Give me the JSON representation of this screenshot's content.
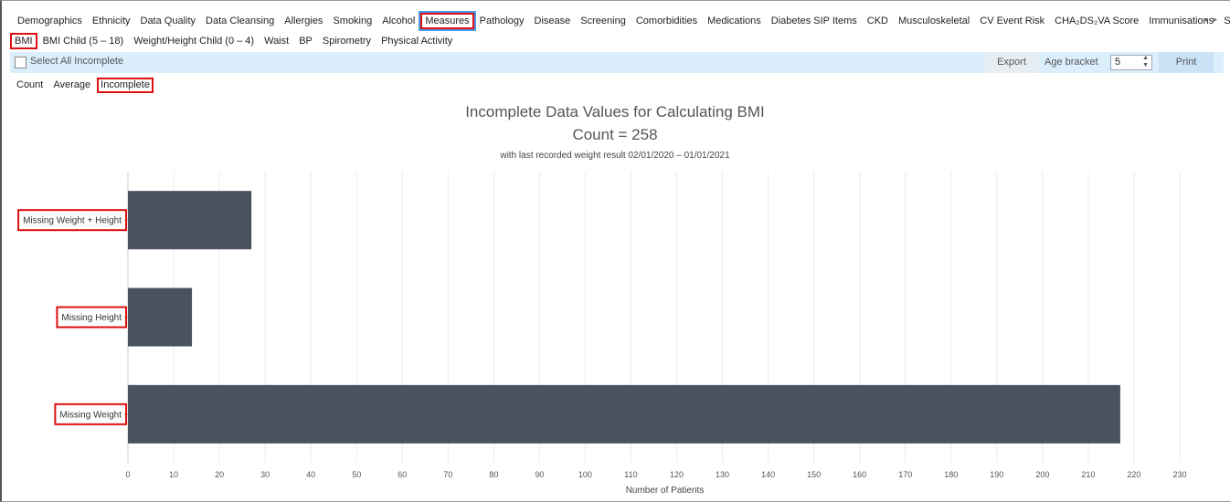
{
  "nav": {
    "main_tabs": [
      "Demographics",
      "Ethnicity",
      "Data Quality",
      "Data Cleansing",
      "Allergies",
      "Smoking",
      "Alcohol",
      "Measures",
      "Pathology",
      "Disease",
      "Screening",
      "Comorbidities",
      "Medications",
      "Diabetes SIP Items",
      "CKD",
      "Musculoskeletal",
      "CV Event Risk",
      "CHA₂DS₂VA Score",
      "Immunisations",
      "Standard Re"
    ],
    "main_active": "Measures",
    "sub_tabs": [
      "BMI",
      "BMI Child (5 – 18)",
      "Weight/Height Child (0 – 4)",
      "Waist",
      "BP",
      "Spirometry",
      "Physical Activity"
    ],
    "sub_active": "BMI"
  },
  "toolbar": {
    "select_all_label": "Select All Incomplete",
    "export_label": "Export",
    "age_bracket_label": "Age bracket",
    "age_bracket_value": "5",
    "print_label": "Print"
  },
  "modes": {
    "items": [
      "Count",
      "Average",
      "Incomplete"
    ],
    "active": "Incomplete"
  },
  "chart_data": {
    "type": "bar",
    "orientation": "horizontal",
    "title": "Incomplete Data Values for Calculating BMI",
    "subtitle": "Count = 258",
    "note": "with last recorded weight result 02/01/2020 – 01/01/2021",
    "categories": [
      "Missing Weight + Height",
      "Missing Height",
      "Missing Weight"
    ],
    "values": [
      27,
      14,
      217
    ],
    "xlabel": "Number of Patients",
    "xlim": [
      0,
      238
    ],
    "xticks": [
      0,
      10,
      20,
      30,
      40,
      50,
      60,
      70,
      80,
      90,
      100,
      110,
      120,
      130,
      140,
      150,
      160,
      170,
      180,
      190,
      200,
      210,
      220,
      230
    ],
    "grid": true,
    "bar_color": "#4a5260"
  }
}
